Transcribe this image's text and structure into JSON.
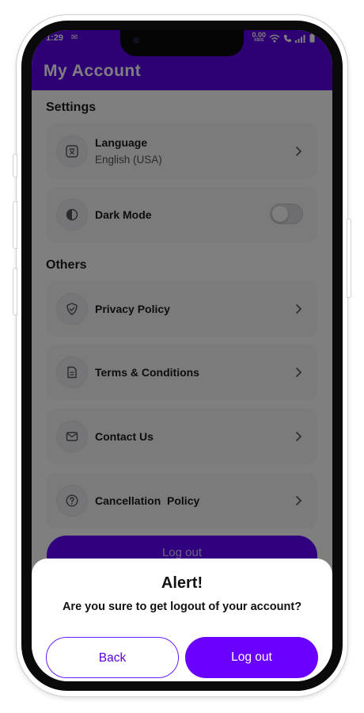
{
  "status_bar": {
    "time": "1:29",
    "mail_glyph": "✉",
    "speed": "0.00",
    "speed_unit": "KB/S"
  },
  "header": {
    "title": "My Account"
  },
  "sections": {
    "settings": {
      "title": "Settings",
      "language": {
        "label": "Language",
        "value": "English (USA)",
        "icon": "translate-icon"
      },
      "dark_mode": {
        "label": "Dark Mode",
        "icon": "contrast-icon",
        "enabled": false
      }
    },
    "others": {
      "title": "Others",
      "privacy": {
        "label": "Privacy Policy",
        "icon": "shield-check-icon"
      },
      "terms": {
        "label": "Terms & Conditions",
        "icon": "document-icon"
      },
      "contact": {
        "label": "Contact Us",
        "icon": "mail-icon"
      },
      "cancellation": {
        "label": "Cancellation  Policy",
        "icon": "question-icon"
      }
    }
  },
  "background_logout_label": "Log out",
  "alert": {
    "title": "Alert!",
    "message": "Are you sure to get logout of your account?",
    "back_label": "Back",
    "logout_label": "Log out"
  },
  "colors": {
    "primary": "#6a00ff",
    "header": "#5a00e6",
    "overlay": "rgba(0,0,0,0.5)"
  }
}
